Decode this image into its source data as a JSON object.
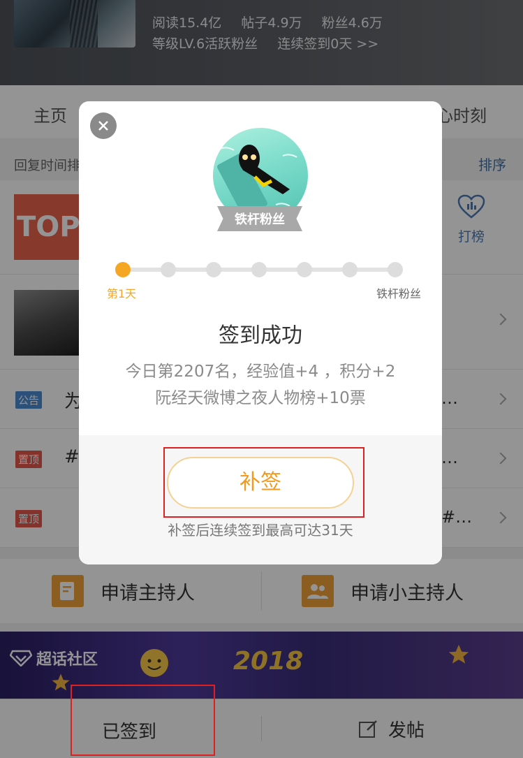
{
  "header": {
    "stats_line1": [
      "阅读15.4亿",
      "帖子4.9万",
      "粉丝4.6万"
    ],
    "stats_line2": "等级LV.6活跃粉丝",
    "checkin_streak": "连续签到0天 >>"
  },
  "tabs": {
    "home": "主页",
    "right_partial": "心时刻"
  },
  "sortbar": {
    "left": "回复时间排",
    "right": "排序"
  },
  "rows": {
    "top_thumb": "TOP",
    "dabang_label": "打榜",
    "announcement_tag": "公告",
    "announcement_lead": "为",
    "announcement_tail": "…",
    "pin_tag": "置顶",
    "pin1_lead": "#",
    "pin1_tail": "…",
    "pin2_tail": "#…"
  },
  "actions": {
    "apply_host": "申请主持人",
    "apply_minor_host": "申请小主持人"
  },
  "banner": {
    "brand": "超话社区",
    "year": "2018"
  },
  "bottombar": {
    "signed": "已签到",
    "post": "发帖"
  },
  "modal": {
    "badge_label": "铁杆粉丝",
    "progress": {
      "current_step": 1,
      "total_steps": 7,
      "start_label": "第1天",
      "end_label": "铁杆粉丝"
    },
    "title": "签到成功",
    "info_line1": "今日第2207名，经验值+4 ，积分+2",
    "info_line2": "阮经天微博之夜人物榜+10票",
    "resign_button": "补签",
    "resign_note": "补签后连续签到最高可达31天"
  },
  "colors": {
    "accent_orange": "#f5a623",
    "link_blue": "#3f6fa8",
    "highlight_red": "#e02020"
  }
}
